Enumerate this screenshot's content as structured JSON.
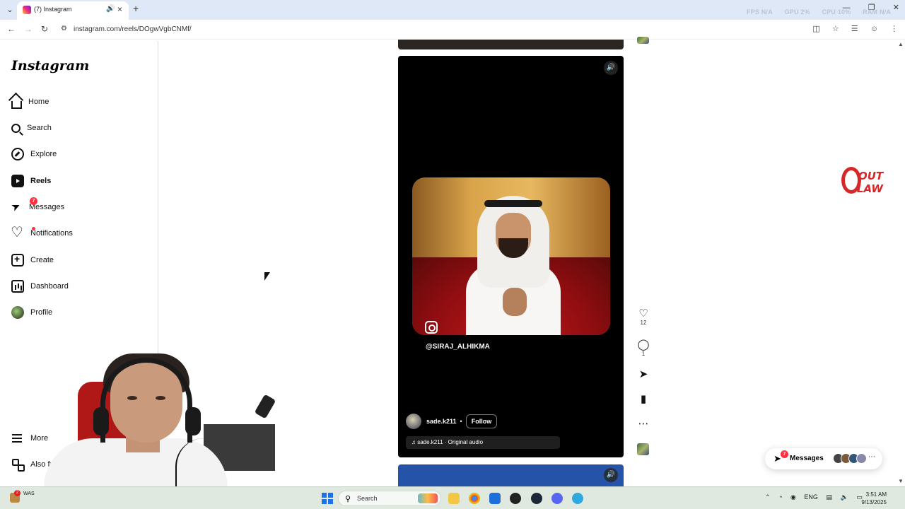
{
  "browser": {
    "tab_title": "(7) Instagram",
    "url": "instagram.com/reels/DOgwVgbCNMf/",
    "overlay_stats": [
      "FPS N/A",
      "GPU 2%",
      "CPU 10%",
      "RAM N/A"
    ]
  },
  "sidebar": {
    "logo": "Instagram",
    "items": [
      {
        "label": "Home",
        "icon": "home-icon"
      },
      {
        "label": "Search",
        "icon": "search-icon"
      },
      {
        "label": "Explore",
        "icon": "compass-icon"
      },
      {
        "label": "Reels",
        "icon": "reels-icon",
        "active": true
      },
      {
        "label": "Messages",
        "icon": "send-icon",
        "badge": "7"
      },
      {
        "label": "Notifications",
        "icon": "heart-icon",
        "dot": true
      },
      {
        "label": "Create",
        "icon": "plus-icon"
      },
      {
        "label": "Dashboard",
        "icon": "dashboard-icon"
      },
      {
        "label": "Profile",
        "icon": "avatar-icon"
      }
    ],
    "more": "More",
    "also_from": "Also from Meta"
  },
  "reel": {
    "watermark_handle": "@SIRAJ_ALHIKMA",
    "author": "sade.k211",
    "separator": "•",
    "follow": "Follow",
    "audio": "♫ sade.k211 · Original audio"
  },
  "actions": {
    "likes": "12",
    "comments": "1"
  },
  "messages_pill": {
    "label": "Messages",
    "badge": "7"
  },
  "taskbar": {
    "left_app_label": "WAS",
    "left_app_badge": "2",
    "search_label": "Search",
    "lang": "ENG",
    "time": "3:51 AM",
    "date": "9/13/2025"
  },
  "colors": {
    "accent_red": "#ff3040",
    "outlaw_red": "#d62828",
    "reel_bg": "#000000"
  }
}
